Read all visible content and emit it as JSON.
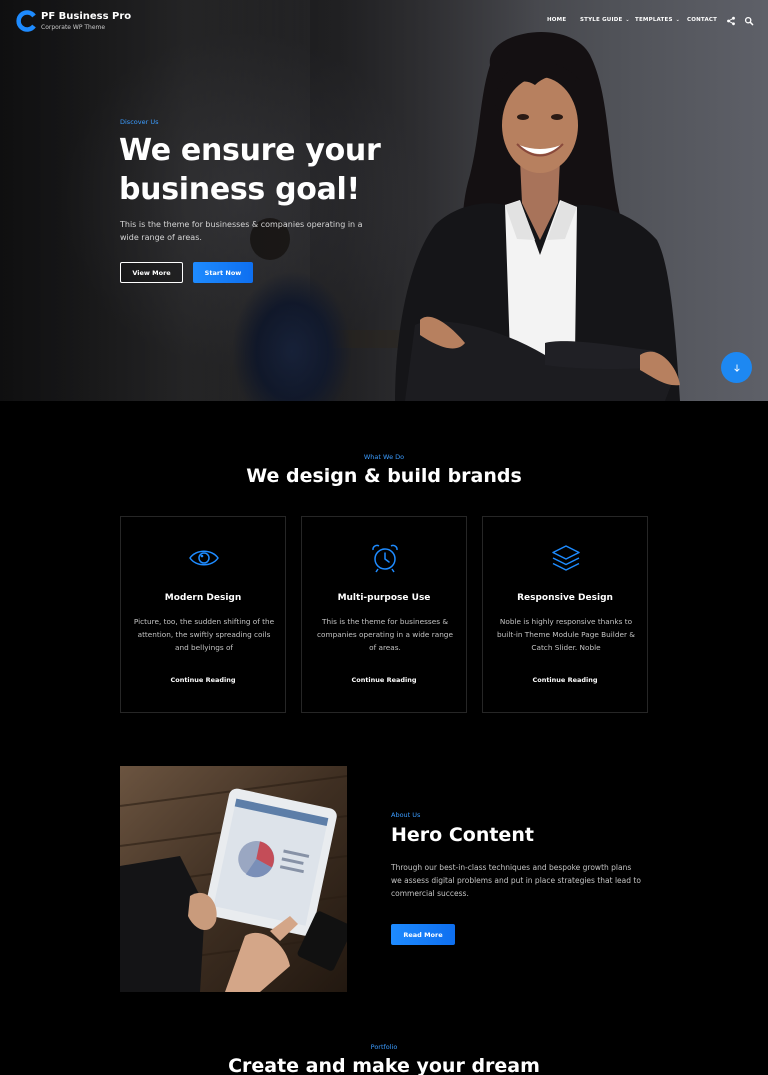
{
  "brand": {
    "title": "PF Business Pro",
    "subtitle": "Corporate WP Theme",
    "accent_color": "#1e8bff"
  },
  "nav": {
    "items": [
      {
        "label": "HOME",
        "dropdown": false
      },
      {
        "label": "STYLE GUIDE",
        "dropdown": true
      },
      {
        "label": "TEMPLATES",
        "dropdown": true
      },
      {
        "label": "CONTACT",
        "dropdown": false
      }
    ],
    "icons": [
      "share-icon",
      "search-icon"
    ]
  },
  "hero": {
    "kicker": "Discover Us",
    "title": "We ensure your business goal!",
    "description": "This is the theme for businesses & companies operating in a wide range of areas.",
    "button_primary": "View More",
    "button_secondary": "Start Now",
    "scroll_icon": "arrow-down-icon"
  },
  "services": {
    "kicker": "What We Do",
    "title": "We design & build brands",
    "cards": [
      {
        "icon": "eye-icon",
        "title": "Modern Design",
        "text": "Picture, too, the sudden shifting of the attention, the swiftly spreading coils and bellyings of",
        "link": "Continue Reading"
      },
      {
        "icon": "alarm-clock-icon",
        "title": "Multi-purpose Use",
        "text": "This is the theme for businesses & companies operating in a wide range of areas.",
        "link": "Continue Reading"
      },
      {
        "icon": "layers-icon",
        "title": "Responsive Design",
        "text": "Noble is highly responsive thanks to built-in Theme Module Page Builder & Catch Slider. Noble",
        "link": "Continue Reading"
      }
    ]
  },
  "about": {
    "kicker": "About Us",
    "title": "Hero Content",
    "text": "Through our best-in-class techniques and bespoke growth plans we assess digital problems and put in place strategies that lead to commercial success.",
    "button": "Read More"
  },
  "portfolio": {
    "kicker": "Portfolio",
    "title": "Create and make your dream"
  }
}
